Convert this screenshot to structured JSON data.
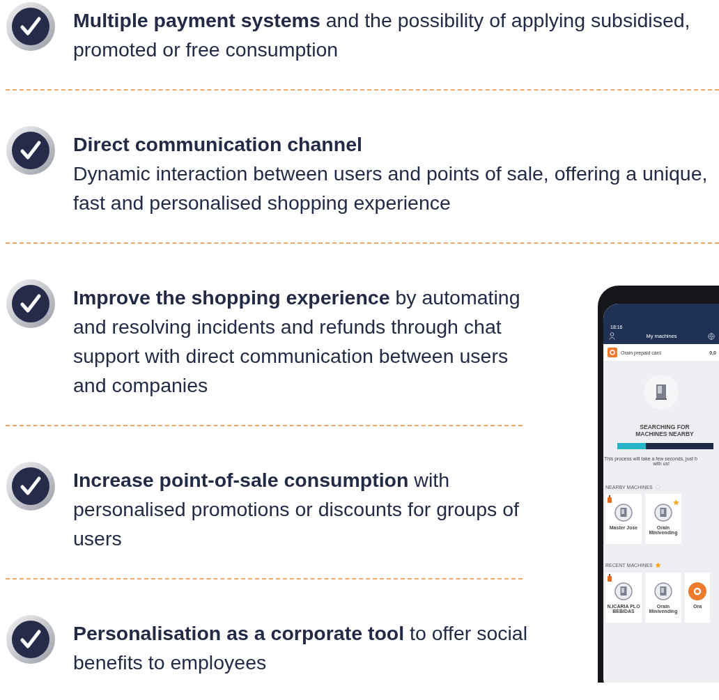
{
  "features": [
    {
      "title": "Multiple payment systems",
      "text": "and the possibility of applying subsidised, promoted or free consumption",
      "kind": "inline"
    },
    {
      "title": "Direct communication channel",
      "text": "Dynamic interaction between users and points of sale, offering a unique, fast and personalised shopping experience",
      "kind": "block"
    },
    {
      "title": "Improve the shopping experience",
      "text": "by automating and resolving incidents and refunds through chat support with direct communication between users and companies",
      "kind": "inline"
    },
    {
      "title": "Increase point-of-sale consumption",
      "text": "with personalised promotions or discounts for groups of users",
      "kind": "inline"
    },
    {
      "title": "Personalisation as a corporate tool",
      "text": "to offer social benefits to employees",
      "kind": "inline"
    }
  ],
  "phone": {
    "time": "18:16",
    "title": "My machines",
    "card": {
      "label": "Orain prepaid card",
      "balance": "0,0"
    },
    "search": {
      "heading": "SEARCHING FOR MACHINES NEARBY",
      "level": 0.3,
      "message": "This process will take a few seconds, just b",
      "message_2": "with us!"
    },
    "sections": [
      {
        "title": "NEARBY MACHINES",
        "kind": "nearby",
        "tiles": [
          {
            "label": "Master Jose",
            "kind": "machine",
            "promo": true,
            "favorite": false
          },
          {
            "label": "Orain Minivending",
            "kind": "machine",
            "promo": false,
            "favorite": true
          }
        ]
      },
      {
        "title": "RECENT MACHINES",
        "kind": "recent",
        "tiles": [
          {
            "label": "N.ICARIA PLO BEBIDAS",
            "kind": "machine",
            "promo": true,
            "favorite": false
          },
          {
            "label": "Orain Minivending",
            "kind": "machine",
            "promo": false,
            "favorite": false
          },
          {
            "label": "Ora",
            "kind": "brand",
            "promo": false,
            "favorite": false
          }
        ]
      }
    ]
  }
}
